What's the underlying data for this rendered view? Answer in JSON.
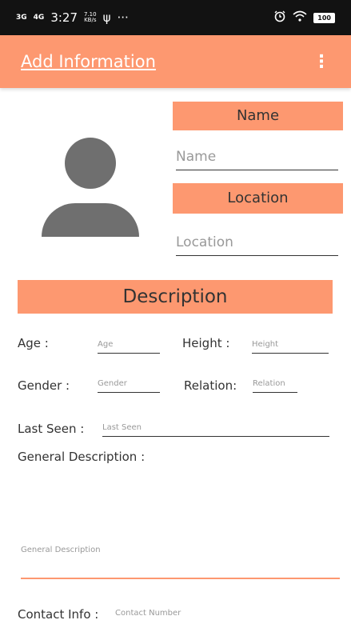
{
  "status_bar": {
    "network_left": "3G",
    "network_right": "4G",
    "time": "3:27",
    "speed_value": "7.10",
    "speed_unit": "KB/s",
    "usb_symbol": "ψ",
    "more": "···",
    "battery": "100"
  },
  "app_bar": {
    "title": "Add Information",
    "overflow_icon": "⋮"
  },
  "profile": {
    "name_heading": "Name",
    "name_placeholder": "Name",
    "location_heading": "Location",
    "location_placeholder": "Location"
  },
  "description": {
    "heading": "Description",
    "age_label": "Age :",
    "age_placeholder": "Age",
    "height_label": "Height :",
    "height_placeholder": "Height",
    "gender_label": "Gender :",
    "gender_placeholder": "Gender",
    "relation_label": "Relation:",
    "relation_placeholder": "Relation",
    "last_seen_label": "Last Seen :",
    "last_seen_placeholder": "Last Seen",
    "general_label": "General Description :",
    "general_placeholder": "General Description",
    "contact_label": "Contact Info :",
    "contact_placeholder": "Contact Number"
  },
  "colors": {
    "accent": "#fd9870",
    "status_bar": "#121212",
    "avatar": "#6f6f6f"
  }
}
